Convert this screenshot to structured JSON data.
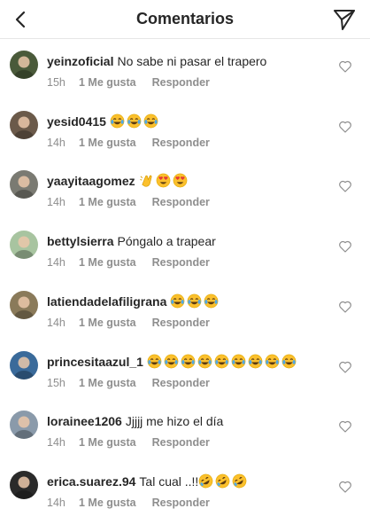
{
  "header": {
    "title": "Comentarios",
    "back_icon": "chevron-left-icon",
    "send_icon": "paper-plane-icon"
  },
  "labels": {
    "like": "1 Me gusta",
    "reply": "Responder"
  },
  "comments": [
    {
      "username": "yeinzoficial",
      "text": "No sabe ni pasar el trapero",
      "emojis": [],
      "time": "15h",
      "avatar_color": "#4a5a3a"
    },
    {
      "username": "yesid0415",
      "text": "",
      "emojis": [
        "laugh",
        "laugh",
        "laugh"
      ],
      "time": "14h",
      "avatar_color": "#6b5a4a"
    },
    {
      "username": "yaayitaagomez",
      "text": "",
      "emojis": [
        "clap",
        "heart-eyes",
        "heart-eyes"
      ],
      "time": "14h",
      "avatar_color": "#7a7a72"
    },
    {
      "username": "bettylsierra",
      "text": "Póngalo a trapear",
      "emojis": [],
      "time": "14h",
      "avatar_color": "#a8c4a0"
    },
    {
      "username": "latiendadelafiligrana",
      "text": "",
      "emojis": [
        "laugh",
        "laugh",
        "laugh"
      ],
      "time": "14h",
      "avatar_color": "#8a7a5a"
    },
    {
      "username": "princesitaazul_1",
      "text": "",
      "emojis": [
        "laugh",
        "laugh",
        "laugh",
        "laugh",
        "laugh",
        "laugh",
        "laugh",
        "laugh",
        "laugh"
      ],
      "time": "15h",
      "avatar_color": "#3a6a9a"
    },
    {
      "username": "lorainee1206",
      "text": "Jjjjj me hizo  el día",
      "emojis": [],
      "time": "14h",
      "avatar_color": "#8a9aaa"
    },
    {
      "username": "erica.suarez.94",
      "text": "Tal cual ..!!",
      "emojis": [
        "rofl",
        "rofl",
        "rofl"
      ],
      "time": "14h",
      "avatar_color": "#2a2a2a"
    }
  ],
  "colors": {
    "text": "#262626",
    "meta": "#8e8e8e",
    "divider": "#e6e6e6",
    "emoji_face": "#fbc02d",
    "heart_eyes": "#e53935"
  }
}
